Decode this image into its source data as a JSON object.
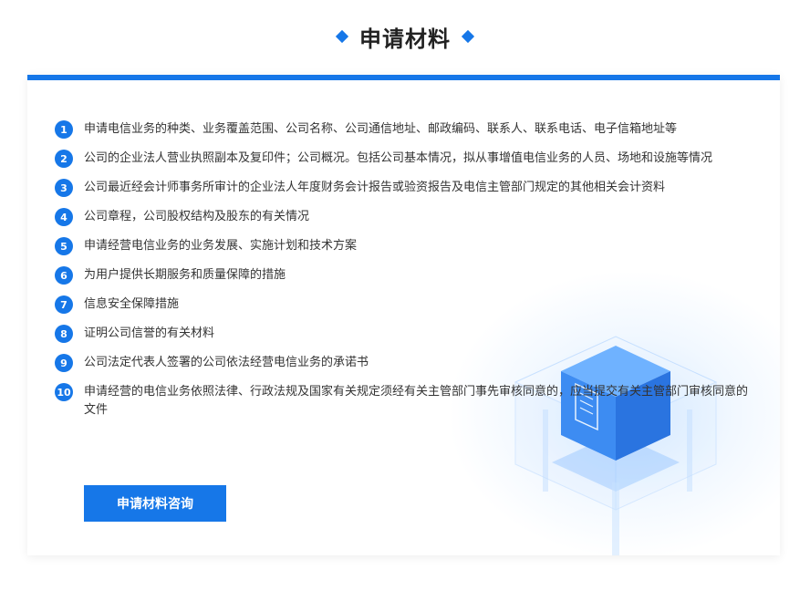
{
  "header": {
    "title": "申请材料"
  },
  "items": [
    {
      "num": "1",
      "text": "申请电信业务的种类、业务覆盖范围、公司名称、公司通信地址、邮政编码、联系人、联系电话、电子信箱地址等"
    },
    {
      "num": "2",
      "text": "公司的企业法人营业执照副本及复印件；公司概况。包括公司基本情况，拟从事增值电信业务的人员、场地和设施等情况"
    },
    {
      "num": "3",
      "text": "公司最近经会计师事务所审计的企业法人年度财务会计报告或验资报告及电信主管部门规定的其他相关会计资料"
    },
    {
      "num": "4",
      "text": "公司章程，公司股权结构及股东的有关情况"
    },
    {
      "num": "5",
      "text": "申请经营电信业务的业务发展、实施计划和技术方案"
    },
    {
      "num": "6",
      "text": "为用户提供长期服务和质量保障的措施"
    },
    {
      "num": "7",
      "text": "信息安全保障措施"
    },
    {
      "num": "8",
      "text": "证明公司信誉的有关材料"
    },
    {
      "num": "9",
      "text": "公司法定代表人签署的公司依法经营电信业务的承诺书"
    },
    {
      "num": "10",
      "text": "申请经营的电信业务依照法律、行政法规及国家有关规定须经有关主管部门事先审核同意的，应当提交有关主管部门审核同意的文件"
    }
  ],
  "consult_button": {
    "label": "申请材料咨询"
  },
  "colors": {
    "accent": "#1677e8"
  },
  "icons": [
    "diamond-icon",
    "document-box-illustration"
  ]
}
